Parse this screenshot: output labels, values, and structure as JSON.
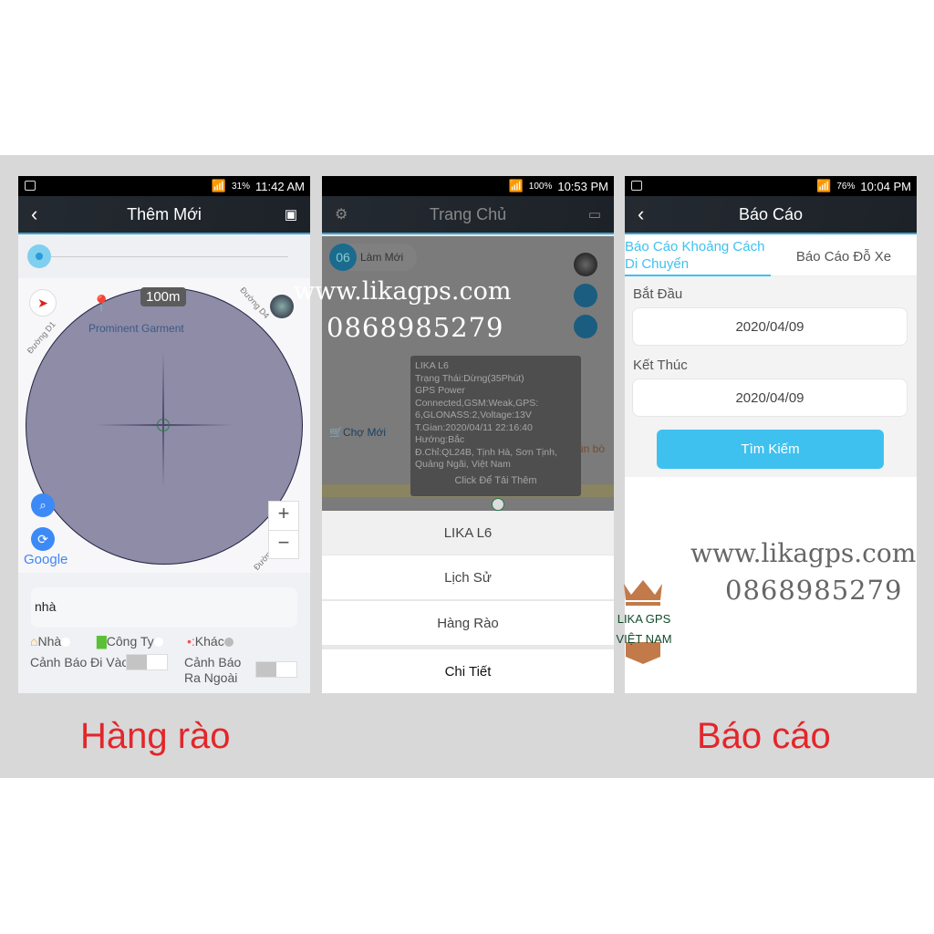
{
  "phone_left": {
    "status": {
      "battery": "31%",
      "time": "11:42 AM"
    },
    "title": "Thêm Mới",
    "map": {
      "radius_label": "100m",
      "place": "Prominent Garment",
      "roads": [
        "Đường D1",
        "Đường D4",
        "Đường N14"
      ],
      "google": "Google",
      "zoom_in": "+",
      "zoom_out": "−"
    },
    "slider_value": 0,
    "name_input": "nhà",
    "types": [
      "Nhà",
      "Công Ty",
      "Khác"
    ],
    "alert_enter": "Cảnh Báo Đi Vào",
    "alert_exit_1": "Cảnh Báo",
    "alert_exit_2": "Ra Ngoài",
    "caption": "Hàng rào"
  },
  "phone_middle": {
    "status": {
      "battery": "100%",
      "time": "10:53 PM"
    },
    "title": "Trang Chủ",
    "refresh_count": "06",
    "refresh_label": "Làm Mới",
    "popup": [
      "LIKA L6",
      "Trạng Thái:Dừng(35Phút)",
      "GPS Power",
      "Connected,GSM:Weak,GPS:",
      "6,GLONASS:2,Voltage:13V",
      "T.Gian:2020/04/11 22:16:40",
      "Hướng:Bắc",
      "Đ.Chỉ:QL24B, Tịnh Hà, Sơn Tịnh,",
      "Quảng Ngãi, Việt Nam"
    ],
    "popup_more": "Click Để Tải Thêm",
    "map_places": [
      "Chợ Mới",
      "Bún bò H"
    ],
    "menu": [
      "LIKA L6",
      "Lịch Sử",
      "Hàng Rào",
      "Chi Tiết"
    ]
  },
  "phone_right": {
    "status": {
      "battery": "76%",
      "time": "10:04 PM"
    },
    "title": "Báo Cáo",
    "tabs": [
      "Báo Cáo Khoảng Cách Di Chuyển",
      "Báo Cáo Đỗ Xe"
    ],
    "start_label": "Bắt Đầu",
    "start_date": "2020/04/09",
    "end_label": "Kết Thúc",
    "end_date": "2020/04/09",
    "search": "Tìm Kiếm",
    "caption": "Báo cáo"
  },
  "watermark": {
    "url": "www.likagps.com",
    "phone": "0868985279",
    "logo_1": "LIKA GPS",
    "logo_2": "VIỆT NAM"
  },
  "colors": {
    "accent": "#3fc1ef",
    "caption": "#e3262b",
    "fence": "#8e8ca6"
  }
}
